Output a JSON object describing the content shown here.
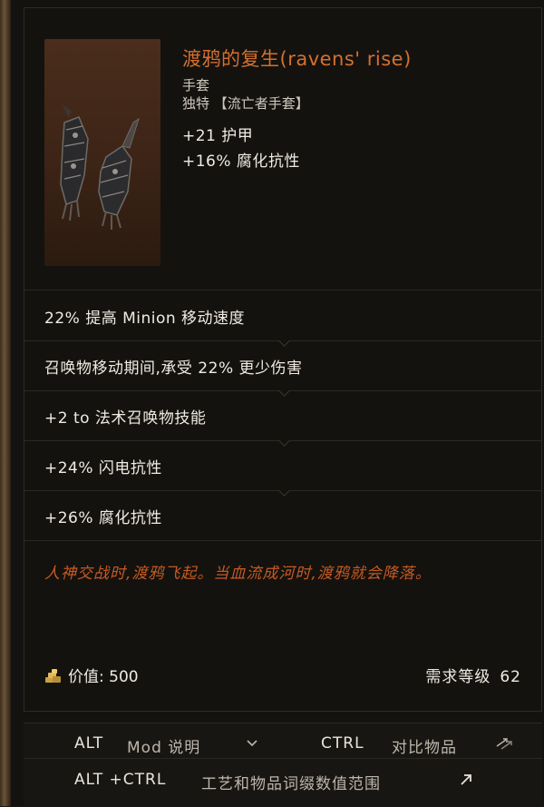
{
  "item": {
    "name": "渡鸦的复生(ravens' rise)",
    "type": "手套",
    "rarity": "独特 【流亡者手套】",
    "implicits": [
      "+21 护甲",
      "+16% 腐化抗性"
    ],
    "affixes": [
      "22% 提高 Minion 移动速度",
      "召唤物移动期间,承受 22% 更少伤害",
      "+2 to 法术召唤物技能",
      "+24% 闪电抗性",
      "+26% 腐化抗性"
    ],
    "lore": "人神交战时,渡鸦飞起。当血流成河时,渡鸦就会降落。",
    "price_label": "价值: 500",
    "level_label": "需求等级",
    "level_value": "62"
  },
  "footer": {
    "alt_key": "ALT",
    "mod_label": "Mod 说明",
    "ctrl_key": "CTRL",
    "compare_label": "对比物品",
    "alt_ctrl_key": "ALT +CTRL",
    "affix_label": "工艺和物品词缀数值范围"
  },
  "icons": {
    "gold": "gold-coins-icon",
    "chevron": "chevron-down-icon",
    "swap": "swap-arrows-icon",
    "expand": "expand-arrow-icon"
  },
  "colors": {
    "unique_name": "#d4702e",
    "lore": "#c65a22",
    "background": "#14120f"
  }
}
